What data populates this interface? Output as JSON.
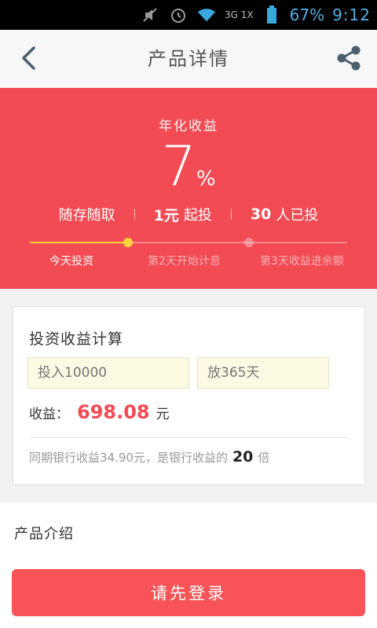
{
  "status_bar": {
    "network": "3G 1X",
    "battery": "67%",
    "time": "9:12"
  },
  "header": {
    "title": "产品详情",
    "back_icon": "chevron-left-icon",
    "share_icon": "share-icon"
  },
  "hero": {
    "rate_label": "年化收益",
    "rate_value": "7",
    "rate_unit": "%",
    "facts": {
      "withdraw": "随存随取",
      "min_amount": "1元",
      "min_suffix": "起投",
      "investors": "30",
      "investors_suffix": "人已投"
    },
    "steps": [
      "今天投资",
      "第2天开始计息",
      "第3天收益进余额"
    ],
    "active_step_index": 0,
    "progress_fraction": 0.31
  },
  "calculator": {
    "title": "投资收益计算",
    "amount_placeholder": "投入10000",
    "days_placeholder": "放365天",
    "earn_label": "收益：",
    "earn_value": "698.08",
    "earn_unit": "元",
    "compare_prefix": "同期银行收益34.90元，是银行收益的",
    "compare_multiple": "20",
    "compare_suffix": "倍"
  },
  "intro": {
    "title": "产品介绍"
  },
  "footer": {
    "login_label": "请先登录"
  },
  "colors": {
    "brand_red": "#f24b54",
    "button_red": "#f85458",
    "progress_yellow": "#ffd43b",
    "status_blue": "#4fb1e6"
  }
}
